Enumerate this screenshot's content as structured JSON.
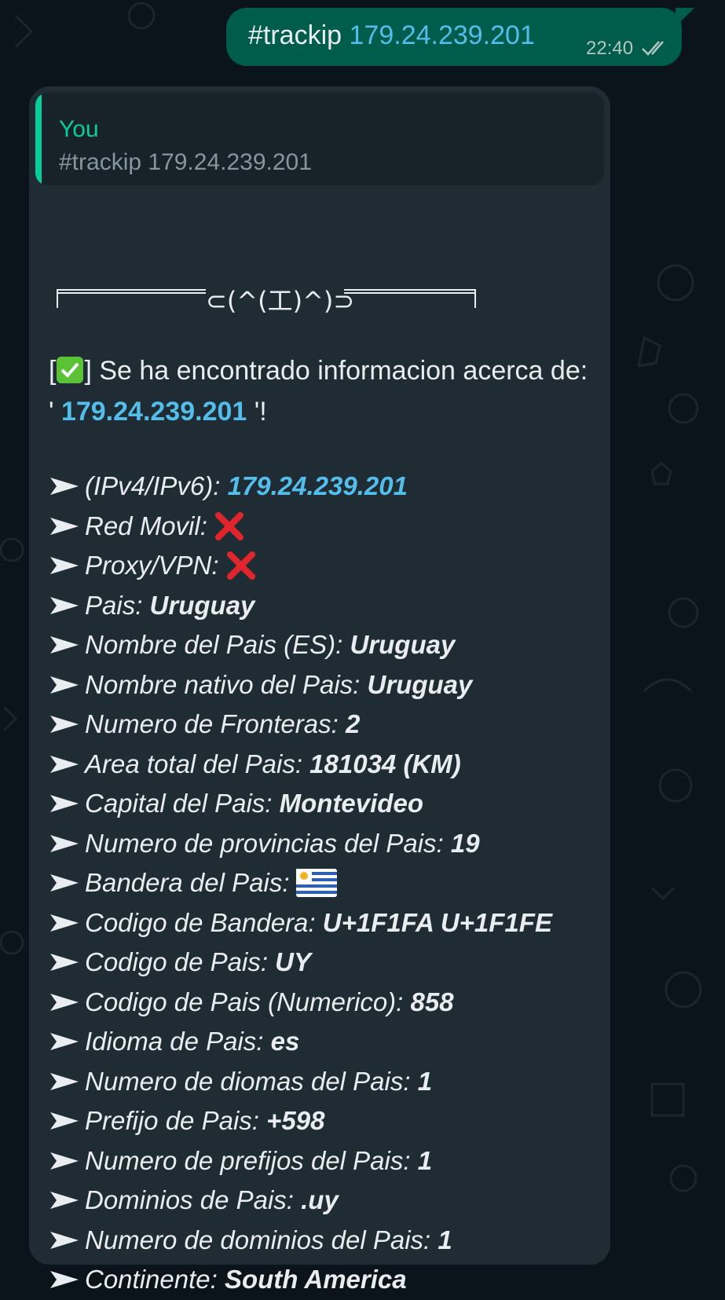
{
  "outgoing": {
    "command": "#trackip",
    "ip": "179.24.239.201",
    "time": "22:40"
  },
  "incoming": {
    "quote_author": "You",
    "quote_text": "#trackip 179.24.239.201",
    "kaomoji": "⊂(^(工)^)⊃",
    "found_prefix": "[",
    "found_suffix": "] Se ha encontrado informacion acerca de: '",
    "found_ip": "179.24.239.201",
    "found_end": "'!",
    "rows": [
      {
        "label": "(IPv4/IPv6):",
        "value": "179.24.239.201"
      },
      {
        "label": "Red Movil:",
        "value": ""
      },
      {
        "label": "Proxy/VPN:",
        "value": ""
      },
      {
        "label": "Pais:",
        "value": "Uruguay"
      },
      {
        "label": "Nombre del Pais (ES):",
        "value": "Uruguay"
      },
      {
        "label": "Nombre nativo del Pais:",
        "value": "Uruguay"
      },
      {
        "label": "Numero de Fronteras:",
        "value": "2"
      },
      {
        "label": "Area total del Pais:",
        "value": "181034 (KM)"
      },
      {
        "label": "Capital del Pais:",
        "value": "Montevideo"
      },
      {
        "label": "Numero de provincias del Pais:",
        "value": "19"
      },
      {
        "label": "Bandera del Pais:",
        "value": ""
      },
      {
        "label": "Codigo de Bandera:",
        "value": "U+1F1FA U+1F1FE"
      },
      {
        "label": "Codigo de Pais:",
        "value": "UY"
      },
      {
        "label": "Codigo de Pais (Numerico):",
        "value": "858"
      },
      {
        "label": "Idioma de Pais:",
        "value": "es"
      },
      {
        "label": "Numero de diomas del Pais:",
        "value": "1"
      },
      {
        "label": "Prefijo de Pais:",
        "value": "+598"
      },
      {
        "label": "Numero de prefijos del Pais:",
        "value": "1"
      },
      {
        "label": "Dominios de Pais:",
        "value": ".uy"
      },
      {
        "label": "Numero de dominios del Pais:",
        "value": "1"
      },
      {
        "label": "Continente:",
        "value": "South America"
      }
    ]
  },
  "colors": {
    "background": "#0b141a",
    "outgoing_bubble": "#005c4b",
    "incoming_bubble": "#1f2c34",
    "link": "#53bdeb",
    "quote_accent": "#06cf9c"
  }
}
